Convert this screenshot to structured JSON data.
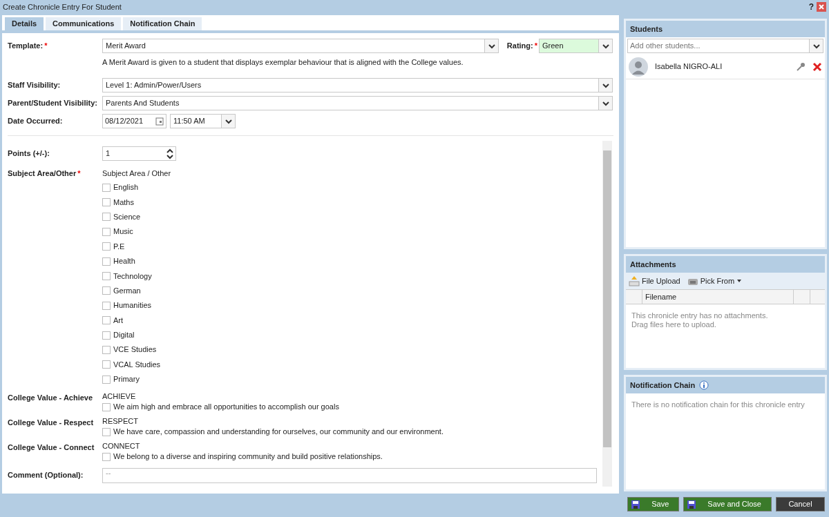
{
  "window": {
    "title": "Create Chronicle Entry For Student",
    "help": "?"
  },
  "tabs": [
    {
      "label": "Details",
      "selected": true
    },
    {
      "label": "Communications",
      "selected": false
    },
    {
      "label": "Notification Chain",
      "selected": false
    }
  ],
  "template": {
    "label": "Template:",
    "required_mark": "*",
    "value": "Merit Award",
    "description": "A Merit Award is given to a student that displays exemplar behaviour that is aligned with the College values."
  },
  "rating": {
    "label": "Rating:",
    "required_mark": "*",
    "value": "Green"
  },
  "staff_visibility": {
    "label": "Staff Visibility:",
    "value": "Level 1: Admin/Power/Users"
  },
  "parent_student_visibility": {
    "label": "Parent/Student Visibility:",
    "value": "Parents And Students"
  },
  "date_occurred": {
    "label": "Date Occurred:",
    "date": "08/12/2021",
    "time": "11:50 AM"
  },
  "points": {
    "label": "Points (+/-):",
    "value": "1"
  },
  "subject_area": {
    "label": "Subject Area/Other",
    "required_mark": "*",
    "heading": "Subject Area / Other",
    "options": [
      {
        "label": "English",
        "checked": false
      },
      {
        "label": "Maths",
        "checked": false
      },
      {
        "label": "Science",
        "checked": false
      },
      {
        "label": "Music",
        "checked": false
      },
      {
        "label": "P.E",
        "checked": false
      },
      {
        "label": "Health",
        "checked": false
      },
      {
        "label": "Technology",
        "checked": false
      },
      {
        "label": "German",
        "checked": false
      },
      {
        "label": "Humanities",
        "checked": false
      },
      {
        "label": "Art",
        "checked": false
      },
      {
        "label": "Digital",
        "checked": false
      },
      {
        "label": "VCE Studies",
        "checked": false
      },
      {
        "label": "VCAL Studies",
        "checked": false
      },
      {
        "label": "Primary",
        "checked": false
      }
    ]
  },
  "college_values": [
    {
      "label": "College Value - Achieve",
      "heading": "ACHIEVE",
      "option": "We aim high and embrace all opportunities to accomplish our goals",
      "checked": false
    },
    {
      "label": "College Value - Respect",
      "heading": "RESPECT",
      "option": "We have care, compassion and understanding for ourselves, our community and our environment.",
      "checked": false
    },
    {
      "label": "College Value - Connect",
      "heading": "CONNECT",
      "option": "We belong to a diverse and inspiring community and build positive relationships.",
      "checked": false
    }
  ],
  "comment": {
    "label": "Comment (Optional):",
    "placeholder": "--"
  },
  "students": {
    "title": "Students",
    "placeholder": "Add other students...",
    "items": [
      {
        "name": "Isabella NIGRO-ALI"
      }
    ]
  },
  "attachments": {
    "title": "Attachments",
    "file_upload": "File Upload",
    "pick_from": "Pick From",
    "columns": [
      "Filename"
    ],
    "empty": "This chronicle entry has no attachments.\nDrag files here to upload."
  },
  "notification_chain": {
    "title": "Notification Chain",
    "empty": "There is no notification chain for this chronicle entry"
  },
  "buttons": [
    {
      "label": "Save",
      "kind": "save"
    },
    {
      "label": "Save and Close",
      "kind": "save"
    },
    {
      "label": "Cancel",
      "kind": "cancel"
    }
  ]
}
